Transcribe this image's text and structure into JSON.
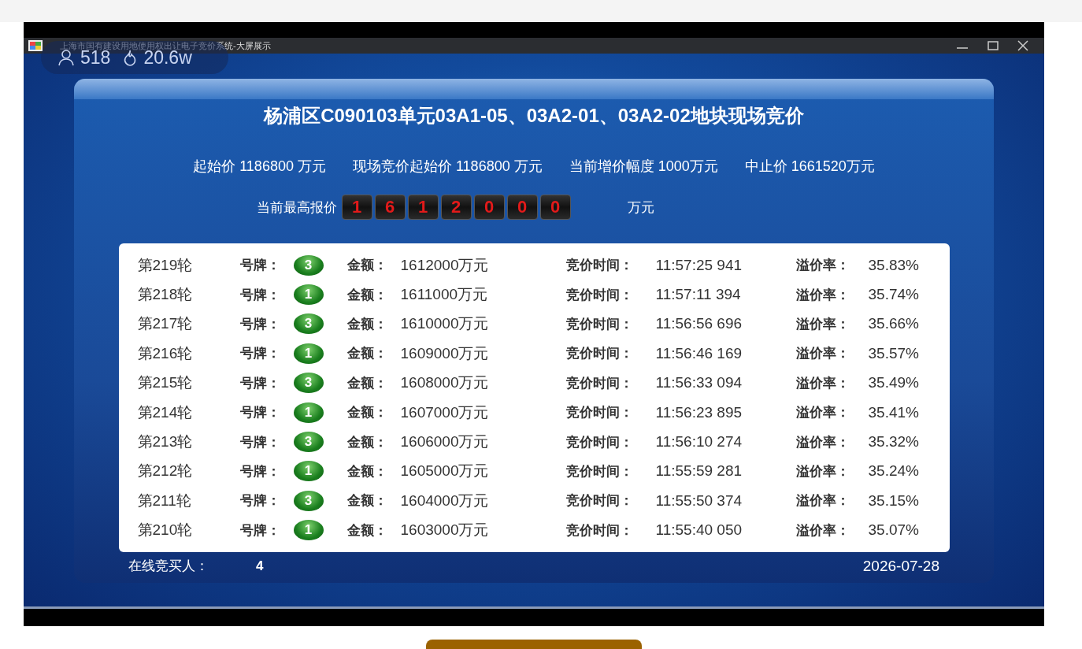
{
  "window": {
    "title": "上海市国有建设用地使用权出让电子竞价系统-大屏展示"
  },
  "overlay": {
    "viewers": "518",
    "heat": "20.6w"
  },
  "auction": {
    "title": "杨浦区C090103单元03A1-05、03A2-01、03A2-02地块现场竞价",
    "prices": [
      "起始价 1186800 万元",
      "现场竞价起始价 1186800 万元",
      "当前增价幅度 1000万元",
      "中止价 1661520万元"
    ],
    "current_bid": {
      "label": "当前最高报价",
      "digits": [
        "1",
        "6",
        "1",
        "2",
        "0",
        "0",
        "0"
      ],
      "unit": "万元"
    },
    "rounds": [
      {
        "round": "第219轮",
        "plate_label": "号牌：",
        "plate": "3",
        "amount_label": "金额：",
        "amount": "1612000万元",
        "time_label": "竞价时间：",
        "time": "11:57:25 941",
        "premium_label": "溢价率：",
        "premium": "35.83%"
      },
      {
        "round": "第218轮",
        "plate_label": "号牌：",
        "plate": "1",
        "amount_label": "金额：",
        "amount": "1611000万元",
        "time_label": "竞价时间：",
        "time": "11:57:11 394",
        "premium_label": "溢价率：",
        "premium": "35.74%"
      },
      {
        "round": "第217轮",
        "plate_label": "号牌：",
        "plate": "3",
        "amount_label": "金额：",
        "amount": "1610000万元",
        "time_label": "竞价时间：",
        "time": "11:56:56 696",
        "premium_label": "溢价率：",
        "premium": "35.66%"
      },
      {
        "round": "第216轮",
        "plate_label": "号牌：",
        "plate": "1",
        "amount_label": "金额：",
        "amount": "1609000万元",
        "time_label": "竞价时间：",
        "time": "11:56:46 169",
        "premium_label": "溢价率：",
        "premium": "35.57%"
      },
      {
        "round": "第215轮",
        "plate_label": "号牌：",
        "plate": "3",
        "amount_label": "金额：",
        "amount": "1608000万元",
        "time_label": "竞价时间：",
        "time": "11:56:33 094",
        "premium_label": "溢价率：",
        "premium": "35.49%"
      },
      {
        "round": "第214轮",
        "plate_label": "号牌：",
        "plate": "1",
        "amount_label": "金额：",
        "amount": "1607000万元",
        "time_label": "竞价时间：",
        "time": "11:56:23 895",
        "premium_label": "溢价率：",
        "premium": "35.41%"
      },
      {
        "round": "第213轮",
        "plate_label": "号牌：",
        "plate": "3",
        "amount_label": "金额：",
        "amount": "1606000万元",
        "time_label": "竞价时间：",
        "time": "11:56:10 274",
        "premium_label": "溢价率：",
        "premium": "35.32%"
      },
      {
        "round": "第212轮",
        "plate_label": "号牌：",
        "plate": "1",
        "amount_label": "金额：",
        "amount": "1605000万元",
        "time_label": "竞价时间：",
        "time": "11:55:59 281",
        "premium_label": "溢价率：",
        "premium": "35.24%"
      },
      {
        "round": "第211轮",
        "plate_label": "号牌：",
        "plate": "3",
        "amount_label": "金额：",
        "amount": "1604000万元",
        "time_label": "竞价时间：",
        "time": "11:55:50 374",
        "premium_label": "溢价率：",
        "premium": "35.15%"
      },
      {
        "round": "第210轮",
        "plate_label": "号牌：",
        "plate": "1",
        "amount_label": "金额：",
        "amount": "1603000万元",
        "time_label": "竞价时间：",
        "time": "11:55:40 050",
        "premium_label": "溢价率：",
        "premium": "35.07%"
      }
    ],
    "footer": {
      "online_label": "在线竞买人：",
      "online_count": "4",
      "date": "2026-07-28"
    }
  }
}
